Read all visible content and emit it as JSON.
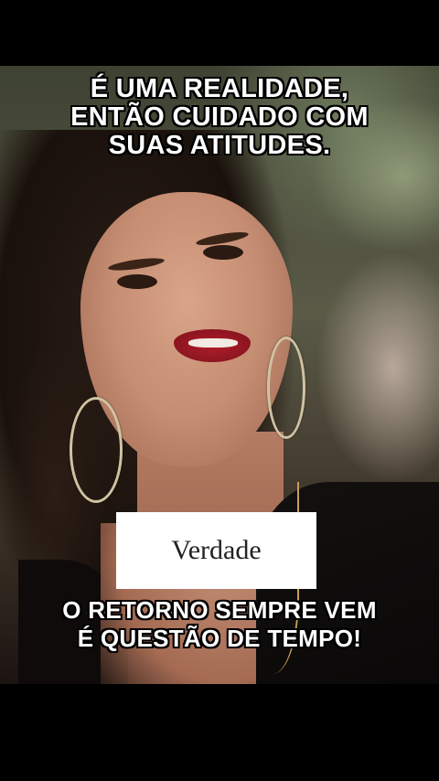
{
  "captions": {
    "top": [
      "É UMA REALIDADE,",
      "ENTÃO CUIDADO COM",
      "SUAS ATITUDES."
    ],
    "bottom": [
      "O RETORNO SEMPRE VEM",
      "É QUESTÃO DE TEMPO!"
    ]
  },
  "label": "Verdade",
  "colors": {
    "caption_text": "#ffffff",
    "caption_outline": "#000000",
    "label_bg": "#ffffff"
  }
}
